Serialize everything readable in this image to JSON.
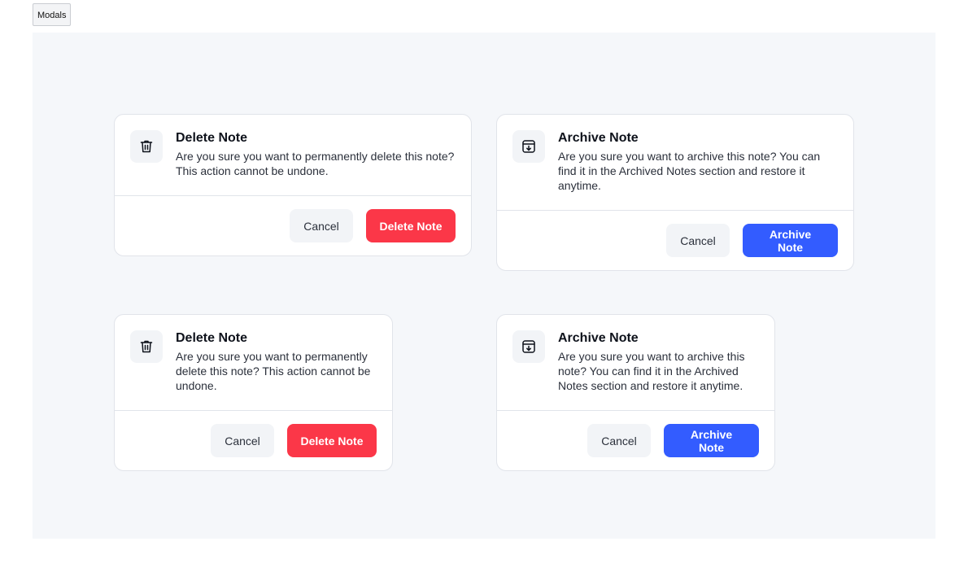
{
  "tab": {
    "label": "Modals"
  },
  "colors": {
    "canvas_bg": "#f5f7fa",
    "danger": "#fb3748",
    "primary": "#335cff",
    "neutral_button": "#f2f4f7"
  },
  "modals": [
    {
      "icon": "trash-icon",
      "title": "Delete Note",
      "description": "Are you sure you want to permanently delete this note? This action cannot be undone.",
      "cancel_label": "Cancel",
      "confirm_label": "Delete Note"
    },
    {
      "icon": "archive-icon",
      "title": "Archive Note",
      "description": "Are you sure you want to archive this note? You can find it in the Archived Notes section and restore it anytime.",
      "cancel_label": "Cancel",
      "confirm_label": "Archive Note"
    },
    {
      "icon": "trash-icon",
      "title": "Delete Note",
      "description": "Are you sure you want to permanently delete this note? This action cannot be undone.",
      "cancel_label": "Cancel",
      "confirm_label": "Delete Note"
    },
    {
      "icon": "archive-icon",
      "title": "Archive Note",
      "description": "Are you sure you want to archive this note? You can find it in the Archived Notes section and restore it anytime.",
      "cancel_label": "Cancel",
      "confirm_label": "Archive Note"
    }
  ]
}
